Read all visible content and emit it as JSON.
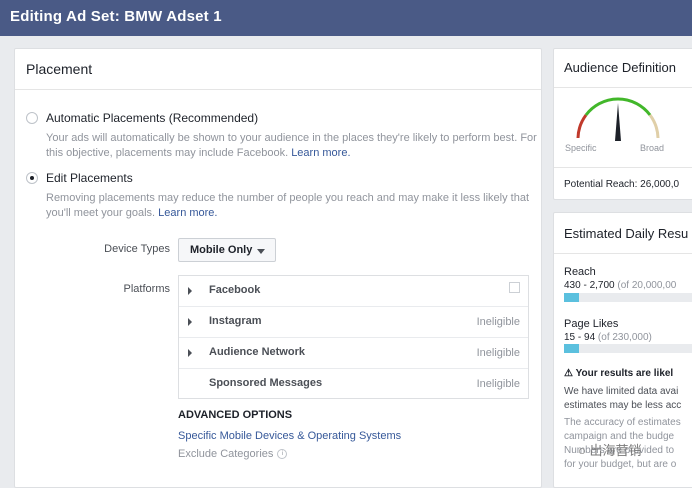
{
  "header": {
    "title": "Editing Ad Set: BMW Adset 1"
  },
  "placement": {
    "title": "Placement",
    "automatic": {
      "label": "Automatic Placements (Recommended)",
      "desc1": "Your ads will automatically be shown to your audience in the places they're likely to perform best. For",
      "desc2": "this objective, placements may include Facebook.",
      "learn_more": "Learn more."
    },
    "edit": {
      "label": "Edit Placements",
      "desc1": "Removing placements may reduce the number of people you reach and may make it less likely that",
      "desc2": "you'll meet your goals.",
      "learn_more": "Learn more."
    },
    "device_types_label": "Device Types",
    "device_types_value": "Mobile Only",
    "platforms_label": "Platforms",
    "platforms": [
      {
        "name": "Facebook",
        "status": ""
      },
      {
        "name": "Instagram",
        "status": "Ineligible"
      },
      {
        "name": "Audience Network",
        "status": "Ineligible"
      },
      {
        "name": "Sponsored Messages",
        "status": "Ineligible"
      }
    ],
    "advanced_title": "ADVANCED OPTIONS",
    "advanced_link": "Specific Mobile Devices & Operating Systems",
    "exclude_label": "Exclude Categories"
  },
  "audience": {
    "title": "Audience Definition",
    "specific": "Specific",
    "broad": "Broad",
    "potential_reach": "Potential Reach: 26,000,0"
  },
  "estimated": {
    "title": "Estimated Daily Resu",
    "reach_label": "Reach",
    "reach_value": "430 - 2,700",
    "reach_total": "(of 20,000,00",
    "reach_fill": 0.11,
    "likes_label": "Page Likes",
    "likes_value": "15 - 94",
    "likes_total": "(of 230,000)",
    "likes_fill": 0.11,
    "warning": "Your results are likel",
    "text1": "We have limited data avai",
    "text2": "estimates may be less acc",
    "text3": "The accuracy of estimates",
    "text4": "campaign and the budge",
    "text5": "Numbers are provided to",
    "text6": "for your budget, but are o"
  },
  "watermark": "出海营销",
  "colors": {
    "topbar": "#4a5a86",
    "link": "#365899",
    "bar_fill": "#5bc0de",
    "gauge_green": "#42b72a",
    "gauge_red": "#c0392b",
    "gauge_tan": "#e0cfa8"
  }
}
